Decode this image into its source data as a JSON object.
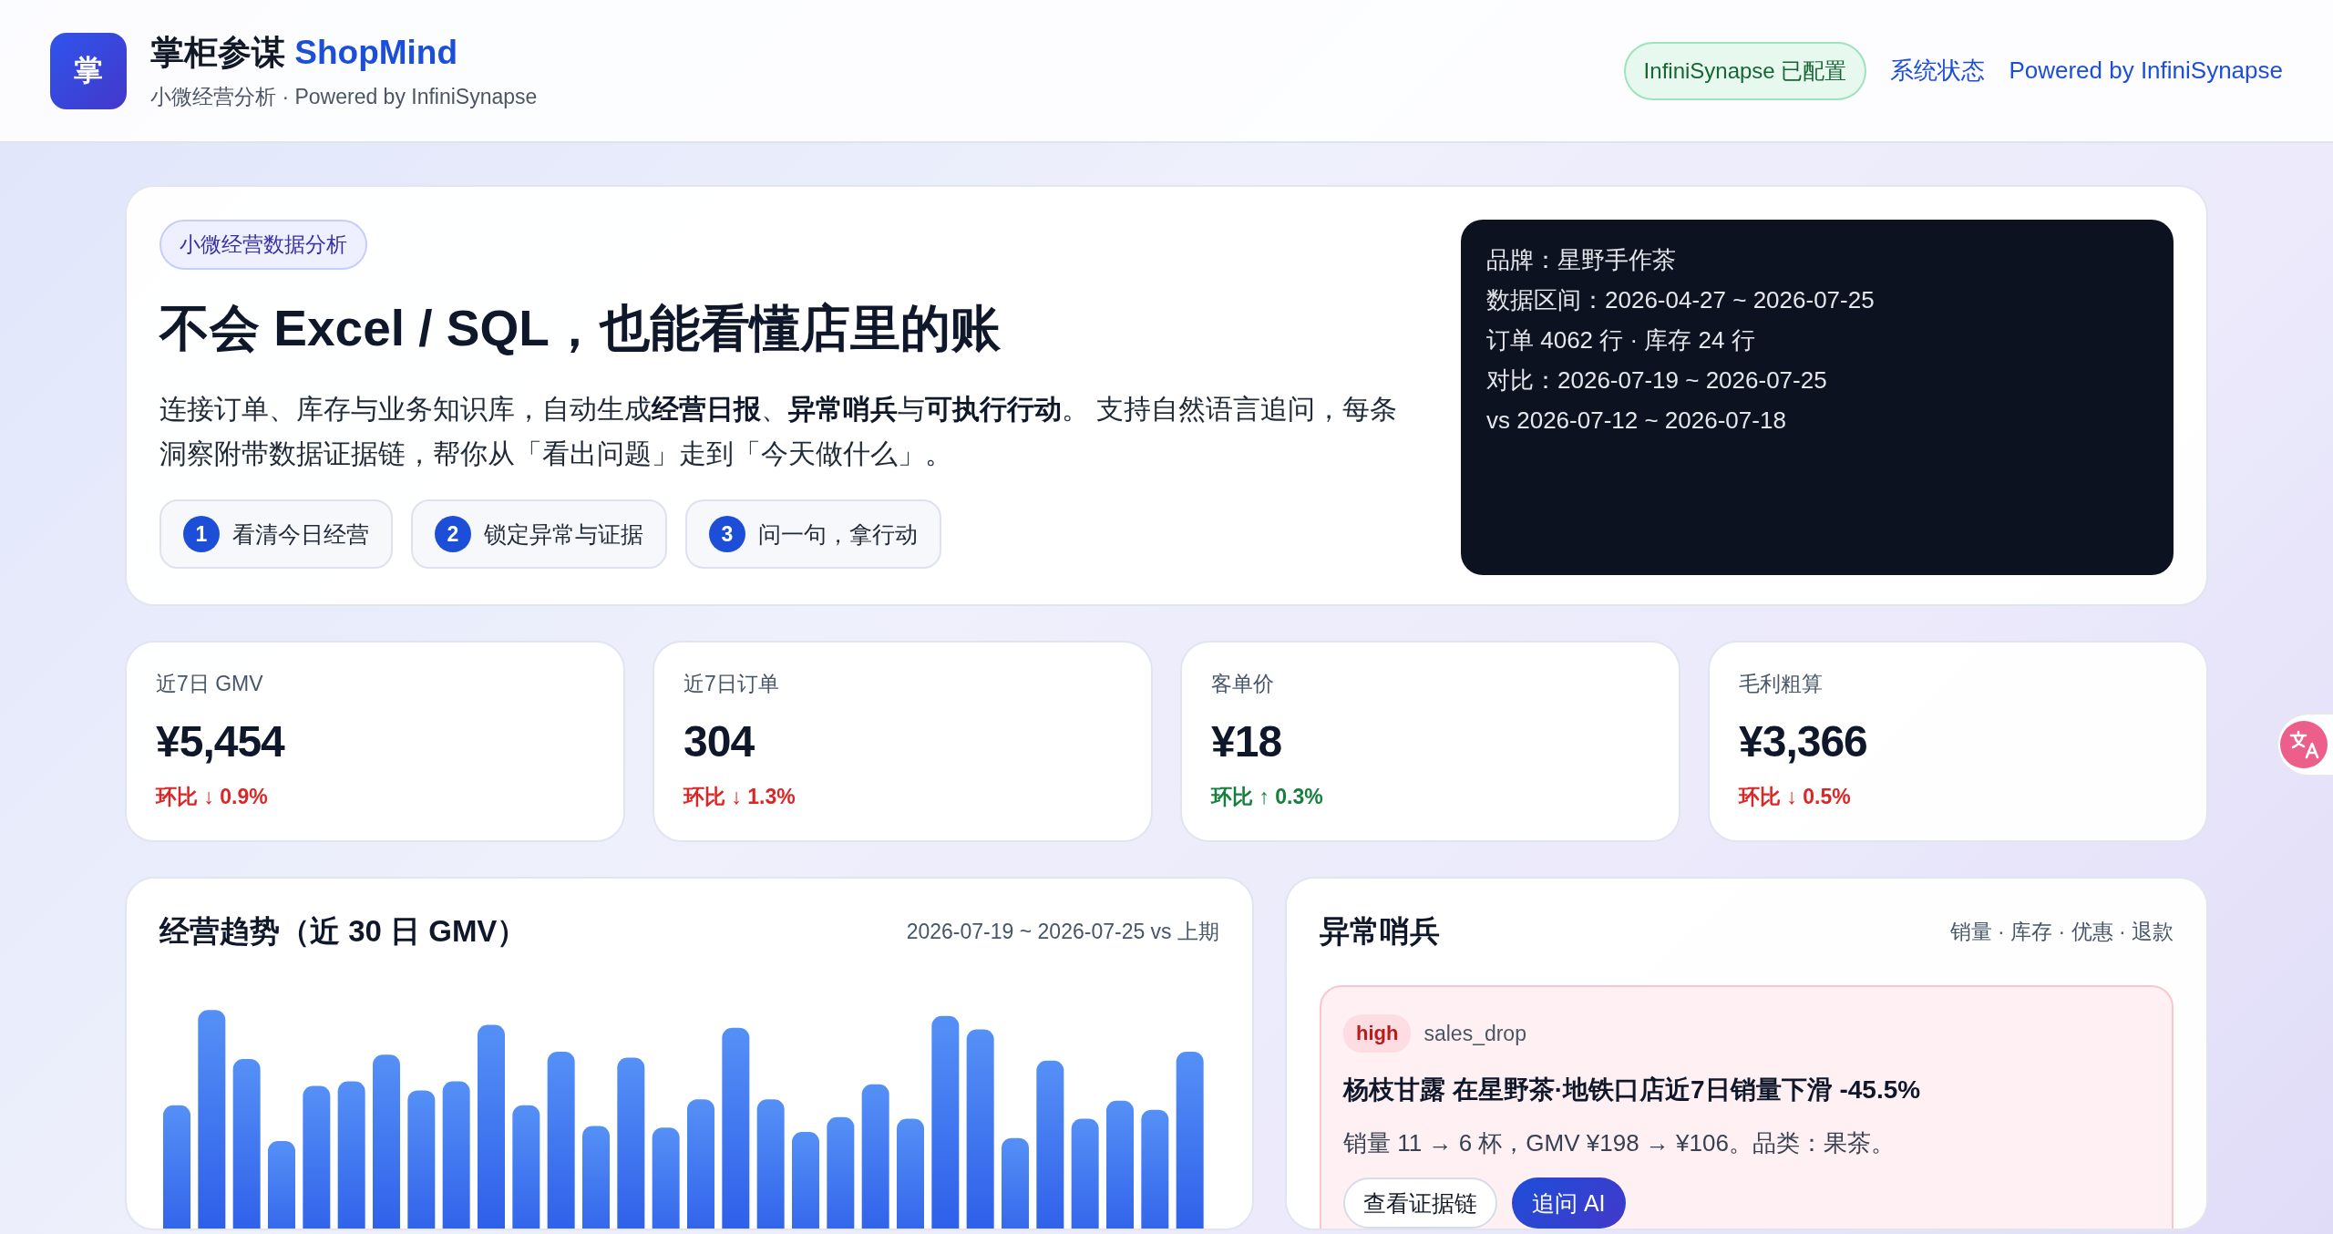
{
  "header": {
    "logo": "掌",
    "title": "掌柜参谋",
    "brand": "ShopMind",
    "subtitle": "小微经营分析 · Powered by InfiniSynapse",
    "status_badge": "InfiniSynapse 已配置",
    "links": [
      "系统状态",
      "Powered by InfiniSynapse"
    ]
  },
  "hero": {
    "tag": "小微经营数据分析",
    "heading": "不会 Excel / SQL，也能看懂店里的账",
    "description": "连接订单、库存与业务知识库，自动生成**经营日报**、**异常哨兵**与**可执行行动**。 支持自然语言追问，每条洞察附带数据证据链，帮你从「看出问题」走到「今天做什么」。",
    "steps": [
      {
        "number": "1",
        "label": "看清今日经营"
      },
      {
        "number": "2",
        "label": "锁定异常与证据"
      },
      {
        "number": "3",
        "label": "问一句，拿行动"
      }
    ],
    "info_lines": [
      "品牌：星野手作茶",
      "数据区间：2026-04-27 ~ 2026-07-25",
      "订单 4062 行 · 库存 24 行",
      "对比：2026-07-19 ~ 2026-07-25",
      "vs 2026-07-12 ~ 2026-07-18"
    ]
  },
  "kpis": [
    {
      "label": "近7日 GMV",
      "value": "¥5,454",
      "delta_label": "环比",
      "arrow": "↓",
      "delta": "0.9%",
      "rising": false
    },
    {
      "label": "近7日订单",
      "value": "304",
      "delta_label": "环比",
      "arrow": "↓",
      "delta": "1.3%",
      "rising": false
    },
    {
      "label": "客单价",
      "value": "¥18",
      "delta_label": "环比",
      "arrow": "↑",
      "delta": "0.3%",
      "rising": true
    },
    {
      "label": "毛利粗算",
      "value": "¥3,366",
      "delta_label": "环比",
      "arrow": "↓",
      "delta": "0.5%",
      "rising": false
    }
  ],
  "trend": {
    "title": "经营趋势（近 30 日 GMV）",
    "range": "2026-07-19 ~ 2026-07-25 vs 上期"
  },
  "alerts": {
    "title": "异常哨兵",
    "categories": "销量 · 库存 · 优惠 · 退款",
    "items": [
      {
        "severity": "high",
        "type": "sales_drop",
        "title": "杨枝甘露 在星野茶·地铁口店近7日销量下滑 -45.5%",
        "detail": "销量 11 → 6 杯，GMV ¥198 → ¥106。品类：果茶。",
        "buttons": [
          {
            "label": "查看证据链",
            "kind": "secondary"
          },
          {
            "label": "追问 AI",
            "kind": "primary"
          }
        ]
      }
    ]
  }
}
